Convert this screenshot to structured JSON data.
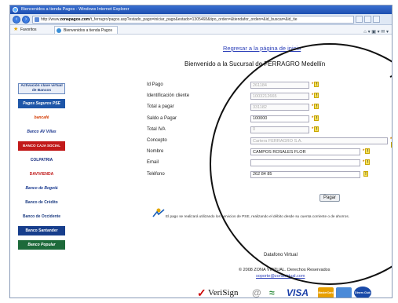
{
  "window": {
    "title": "Bienvenidos a tienda Pagos - Windows Internet Explorer"
  },
  "address": {
    "prefix": "http://www.",
    "domain": "zonapagos.com",
    "path": "/t_ferragro/pagos.asp?estado_pago=iniciar_pago&estado=1305468&tipo_orden=&tiendafor_orden=&id_buscar=&id_tie"
  },
  "favorites": {
    "label": "Favoritos",
    "tab": "Bienvenidos a tienda Pagos"
  },
  "header": {
    "link": "Regresar a la página de inicio",
    "welcome": "Bienvenido a la Sucursal de FERRAGRO Medellín"
  },
  "banks": [
    "Activación clave virtual de Bancos",
    "Pagos Seguros PSE",
    "bancafé",
    "Banco AV Villas",
    "BANCO CAJA SOCIAL",
    "COLPATRIA",
    "DAVIVIENDA",
    "Banco de Bogotá",
    "Banco de Crédito",
    "Banco de Occidente",
    "Banco Santander",
    "Banco Popular"
  ],
  "form": {
    "fields": [
      {
        "label": "Id Pago",
        "value": "261184",
        "readonly": true,
        "width": 75,
        "req": true
      },
      {
        "label": "Identificación cliente",
        "value": "1003212665",
        "readonly": true,
        "width": 75,
        "req": true
      },
      {
        "label": "Total a pagar",
        "value": "331182",
        "readonly": true,
        "width": 75,
        "req": true
      },
      {
        "label": "Saldo a Pagar",
        "value": "100000",
        "readonly": false,
        "width": 75,
        "req": true
      },
      {
        "label": "Total IVA",
        "value": "0",
        "readonly": true,
        "width": 75,
        "req": true
      },
      {
        "label": "Concepto",
        "value": "Cartera FERRAGRO S.A.",
        "readonly": true,
        "width": 175,
        "req": true
      },
      {
        "label": "Nombre",
        "value": "CAMPOS ROSALES FLOR",
        "readonly": false,
        "width": 140,
        "req": true
      },
      {
        "label": "Email",
        "value": "",
        "readonly": false,
        "width": 140,
        "req": true
      },
      {
        "label": "Teléfono",
        "value": "262 84 85",
        "readonly": false,
        "width": 140,
        "req": false
      }
    ],
    "required_mark": "*",
    "submit": "Pagar"
  },
  "pse_note": "El pago se realizará utilizando los servicios de PSE, realizando el débito desde su cuenta corriente o de ahorros.",
  "footer": {
    "dataf": "Datafono Virtual",
    "copyright": "© 2008 ZONA VIRTUAL. Derechos Reservados",
    "email": "soporte@zonavirtual.com",
    "logos": [
      "VeriSign",
      "VISA",
      "MasterCard",
      "Diners Club"
    ]
  },
  "colors": {
    "link": "#2b3fb8",
    "titlebar": "#1d4fb0",
    "req": "#d08000"
  }
}
